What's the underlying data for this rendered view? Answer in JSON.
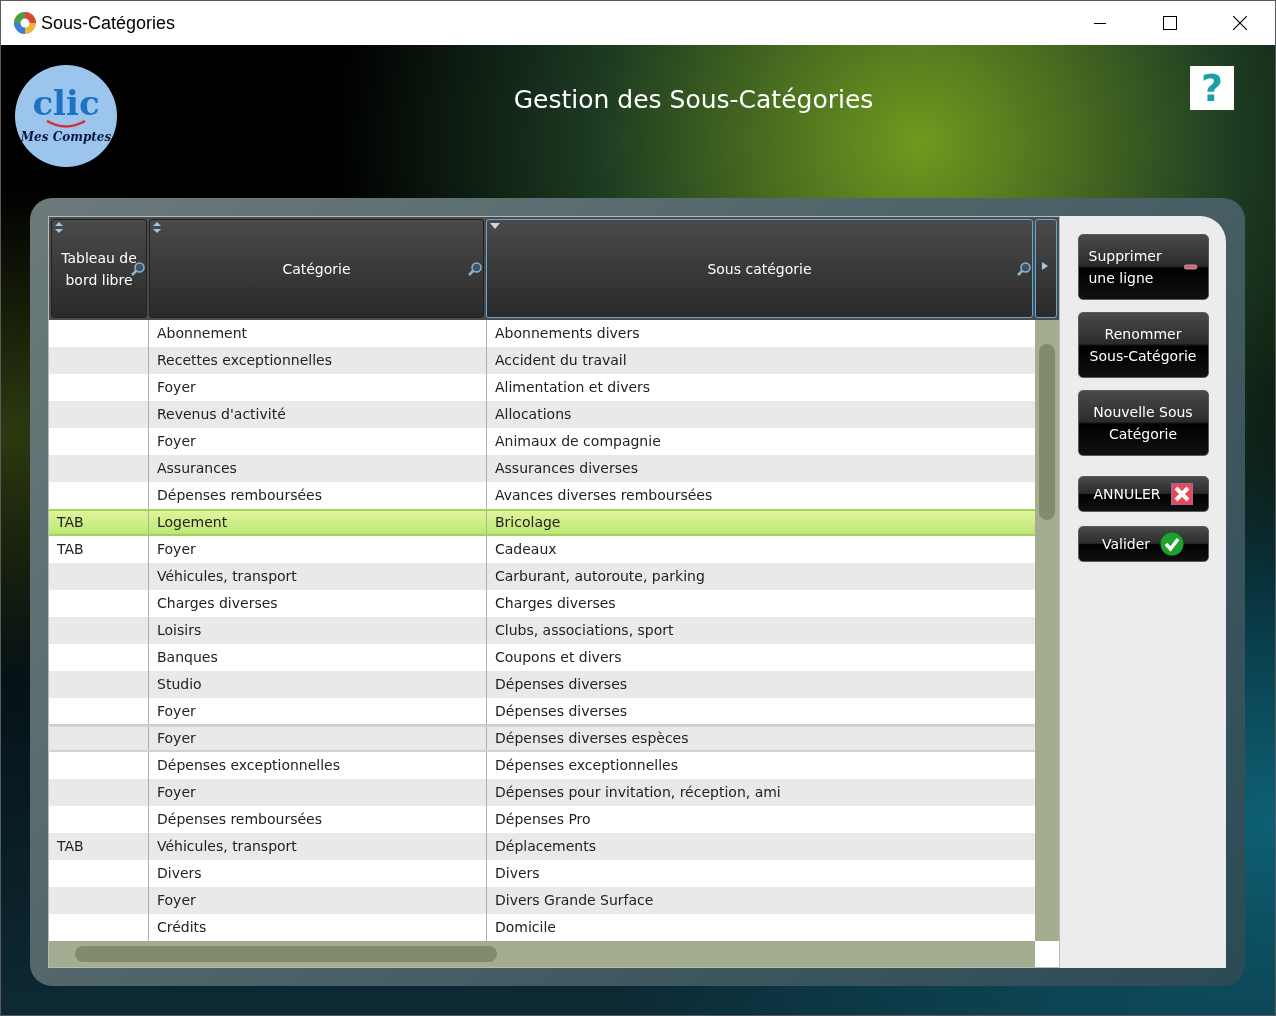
{
  "window": {
    "title": "Sous-Catégories"
  },
  "logo": {
    "word": "clic",
    "tagline": "Mes Comptes"
  },
  "heading": "Gestion des Sous-Catégories",
  "help_button": "?",
  "table": {
    "columns": [
      {
        "label": "Tableau de bord libre",
        "kind": "sort",
        "active": false
      },
      {
        "label": "Catégorie",
        "kind": "sort",
        "active": false
      },
      {
        "label": "Sous catégorie",
        "kind": "sorted",
        "active": true
      }
    ],
    "rows": [
      {
        "cells": [
          "",
          "Abonnement",
          "Abonnements divers"
        ],
        "selected": false,
        "focused": false
      },
      {
        "cells": [
          "",
          "Recettes exceptionnelles",
          "Accident du travail"
        ],
        "selected": false,
        "focused": false
      },
      {
        "cells": [
          "",
          "Foyer",
          "Alimentation et divers"
        ],
        "selected": false,
        "focused": false
      },
      {
        "cells": [
          "",
          "Revenus d'activité",
          "Allocations"
        ],
        "selected": false,
        "focused": false
      },
      {
        "cells": [
          "",
          "Foyer",
          "Animaux de compagnie"
        ],
        "selected": false,
        "focused": false
      },
      {
        "cells": [
          "",
          "Assurances",
          "Assurances diverses"
        ],
        "selected": false,
        "focused": false
      },
      {
        "cells": [
          "",
          "Dépenses remboursées",
          "Avances diverses remboursées"
        ],
        "selected": false,
        "focused": false
      },
      {
        "cells": [
          "TAB",
          "Logement",
          "Bricolage"
        ],
        "selected": true,
        "focused": false
      },
      {
        "cells": [
          "TAB",
          "Foyer",
          "Cadeaux"
        ],
        "selected": false,
        "focused": false
      },
      {
        "cells": [
          "",
          "Véhicules, transport",
          "Carburant, autoroute, parking"
        ],
        "selected": false,
        "focused": false
      },
      {
        "cells": [
          "",
          "Charges diverses",
          "Charges diverses"
        ],
        "selected": false,
        "focused": false
      },
      {
        "cells": [
          "",
          "Loisirs",
          "Clubs, associations, sport"
        ],
        "selected": false,
        "focused": false
      },
      {
        "cells": [
          "",
          "Banques",
          "Coupons et divers"
        ],
        "selected": false,
        "focused": false
      },
      {
        "cells": [
          "",
          "Studio",
          "Dépenses diverses"
        ],
        "selected": false,
        "focused": false
      },
      {
        "cells": [
          "",
          "Foyer",
          "Dépenses diverses"
        ],
        "selected": false,
        "focused": false
      },
      {
        "cells": [
          "",
          "Foyer",
          "Dépenses diverses espèces"
        ],
        "selected": false,
        "focused": true
      },
      {
        "cells": [
          "",
          "Dépenses exceptionnelles",
          "Dépenses exceptionnelles"
        ],
        "selected": false,
        "focused": false
      },
      {
        "cells": [
          "",
          "Foyer",
          "Dépenses pour invitation, réception, ami"
        ],
        "selected": false,
        "focused": false
      },
      {
        "cells": [
          "",
          "Dépenses remboursées",
          "Dépenses Pro"
        ],
        "selected": false,
        "focused": false
      },
      {
        "cells": [
          "TAB",
          "Véhicules, transport",
          "Déplacements"
        ],
        "selected": false,
        "focused": false
      },
      {
        "cells": [
          "",
          "Divers",
          "Divers"
        ],
        "selected": false,
        "focused": false
      },
      {
        "cells": [
          "",
          "Foyer",
          "Divers Grande Surface"
        ],
        "selected": false,
        "focused": false
      },
      {
        "cells": [
          "",
          "Crédits",
          "Domicile"
        ],
        "selected": false,
        "focused": false
      }
    ]
  },
  "buttons": [
    {
      "label": "Supprimer une ligne",
      "kind": "remove"
    },
    {
      "label": "Renommer Sous-Catégorie",
      "kind": "plain"
    },
    {
      "label": "Nouvelle Sous Catégorie",
      "kind": "plain"
    },
    {
      "label": "ANNULER",
      "kind": "cancel"
    },
    {
      "label": "Valider",
      "kind": "ok"
    }
  ]
}
